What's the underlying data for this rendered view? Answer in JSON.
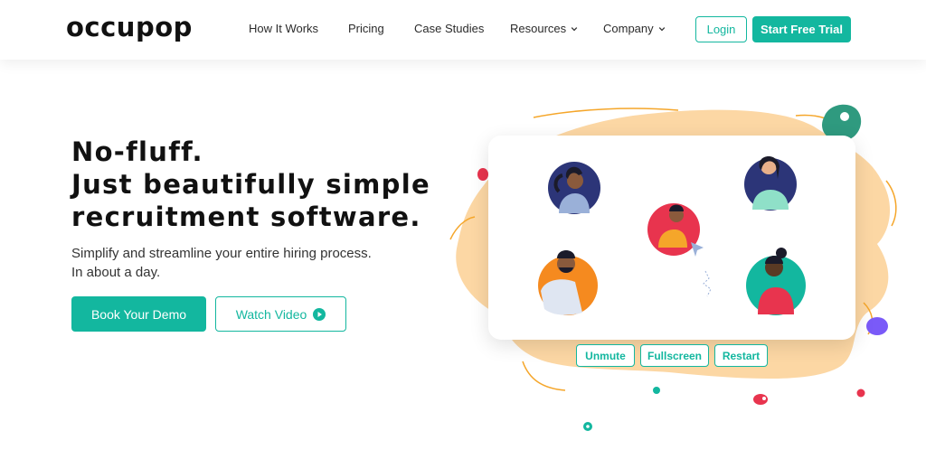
{
  "brand": {
    "logo_text": "occupop",
    "accent": "#13b79f"
  },
  "nav": {
    "items": [
      {
        "label": "How It Works",
        "dropdown": false
      },
      {
        "label": "Pricing",
        "dropdown": false
      },
      {
        "label": "Case Studies",
        "dropdown": false
      },
      {
        "label": "Resources",
        "dropdown": true
      },
      {
        "label": "Company",
        "dropdown": true
      }
    ],
    "login_label": "Login",
    "trial_label": "Start Free Trial"
  },
  "hero": {
    "title_lines": [
      "No-fluff.",
      "Just beautifully simple",
      "recruitment software."
    ],
    "subtitle_lines": [
      "Simplify and streamline your entire hiring process.",
      "In about a day."
    ],
    "demo_label": "Book Your Demo",
    "video_label": "Watch Video"
  },
  "video_controls": {
    "unmute_label": "Unmute",
    "fullscreen_label": "Fullscreen",
    "restart_label": "Restart"
  }
}
